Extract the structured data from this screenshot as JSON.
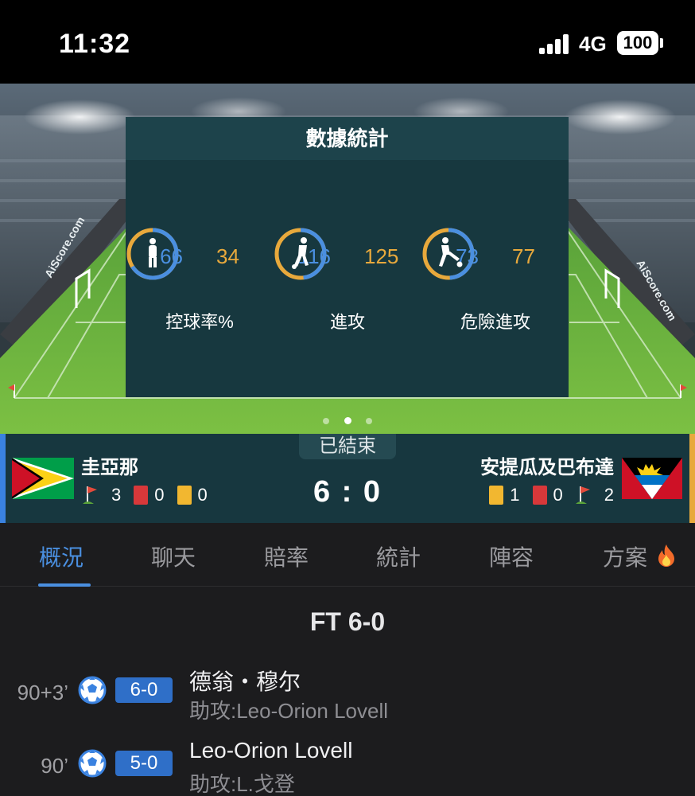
{
  "status_bar": {
    "time": "11:32",
    "network": "4G",
    "battery": "100"
  },
  "stats_panel": {
    "title": "數據統計",
    "stats": [
      {
        "label": "控球率%",
        "home": "66",
        "away": "34",
        "icon": "player-standing-icon",
        "home_fraction": 0.66
      },
      {
        "label": "進攻",
        "home": "116",
        "away": "125",
        "icon": "player-dribbling-icon",
        "home_fraction": 0.48
      },
      {
        "label": "危險進攻",
        "home": "73",
        "away": "77",
        "icon": "player-kicking-icon",
        "home_fraction": 0.49
      }
    ],
    "watermark": "AiScore.com",
    "pages": 3,
    "active_page": 2
  },
  "match": {
    "status": "已結束",
    "score": "6 : 0",
    "home": {
      "name": "圭亞那",
      "flag": "guyana-flag-icon",
      "corners": "3",
      "red_cards": "0",
      "yellow_cards": "0"
    },
    "away": {
      "name": "安提瓜及巴布達",
      "flag": "antigua-barbuda-flag-icon",
      "yellow_cards": "1",
      "red_cards": "0",
      "corners": "2"
    }
  },
  "tabs": [
    {
      "label": "概況",
      "active": true
    },
    {
      "label": "聊天"
    },
    {
      "label": "賠率"
    },
    {
      "label": "統計"
    },
    {
      "label": "陣容"
    },
    {
      "label": "方案",
      "icon": "flame-icon"
    }
  ],
  "events": {
    "title": "FT 6-0",
    "items": [
      {
        "minute": "90+3’",
        "score": "6-0",
        "player": "德翁・穆尔",
        "assist": "助攻:Leo-Orion Lovell",
        "icon": "soccer-ball-icon"
      },
      {
        "minute": "90’",
        "score": "5-0",
        "player": "Leo-Orion Lovell",
        "assist": "助攻:L.戈登",
        "icon": "soccer-ball-icon"
      }
    ]
  },
  "colors": {
    "home": "#4a8fe0",
    "away": "#e8a93c",
    "panel": "#17383f",
    "background": "#1c1c1e"
  }
}
